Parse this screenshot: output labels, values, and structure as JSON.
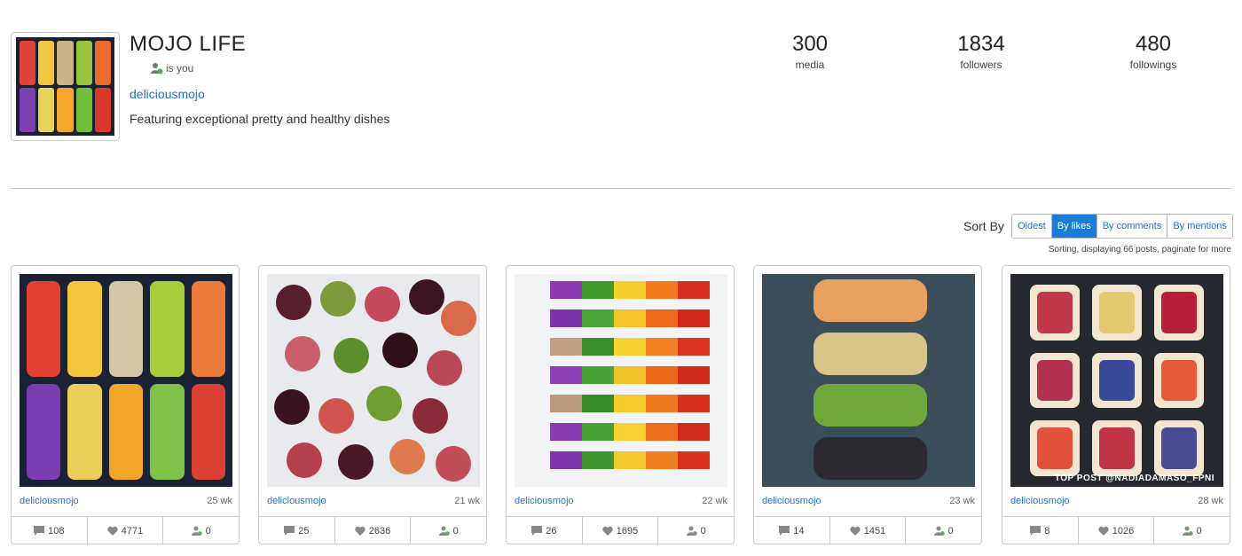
{
  "profile": {
    "name": "MOJO LIFE",
    "is_you": "is you",
    "username": "deliciousmojo",
    "bio": "Featuring exceptional pretty and healthy dishes"
  },
  "stats": [
    {
      "value": "300",
      "label": "media"
    },
    {
      "value": "1834",
      "label": "followers"
    },
    {
      "value": "480",
      "label": "followings"
    }
  ],
  "sort": {
    "label": "Sort By",
    "options": [
      "Oldest",
      "By likes",
      "By comments",
      "By mentions"
    ],
    "active": "By likes",
    "note": "Sorting, displaying 66 posts, paginate for more"
  },
  "posts": [
    {
      "user": "deliciousmojo",
      "age": "25 wk",
      "comments": "108",
      "likes": "4771",
      "mentions": "0"
    },
    {
      "user": "deliciousmojo",
      "age": "21 wk",
      "comments": "25",
      "likes": "2636",
      "mentions": "0"
    },
    {
      "user": "deliciousmojo",
      "age": "22 wk",
      "comments": "26",
      "likes": "1695",
      "mentions": "0"
    },
    {
      "user": "deliciousmojo",
      "age": "23 wk",
      "comments": "14",
      "likes": "1451",
      "mentions": "0"
    },
    {
      "user": "deliciousmojo",
      "age": "28 wk",
      "comments": "8",
      "likes": "1026",
      "mentions": "0"
    }
  ],
  "image_text": {
    "post5_tag": "TOP POST @NADIADAMASO_FPNI"
  },
  "icons": {
    "comment": "comment-icon",
    "like": "heart-icon",
    "mention": "user-mention-icon",
    "is_you": "user-check-icon"
  },
  "colors": {
    "link": "#2a6fc9",
    "active": "#1a7bd9",
    "border": "#cccccc"
  }
}
